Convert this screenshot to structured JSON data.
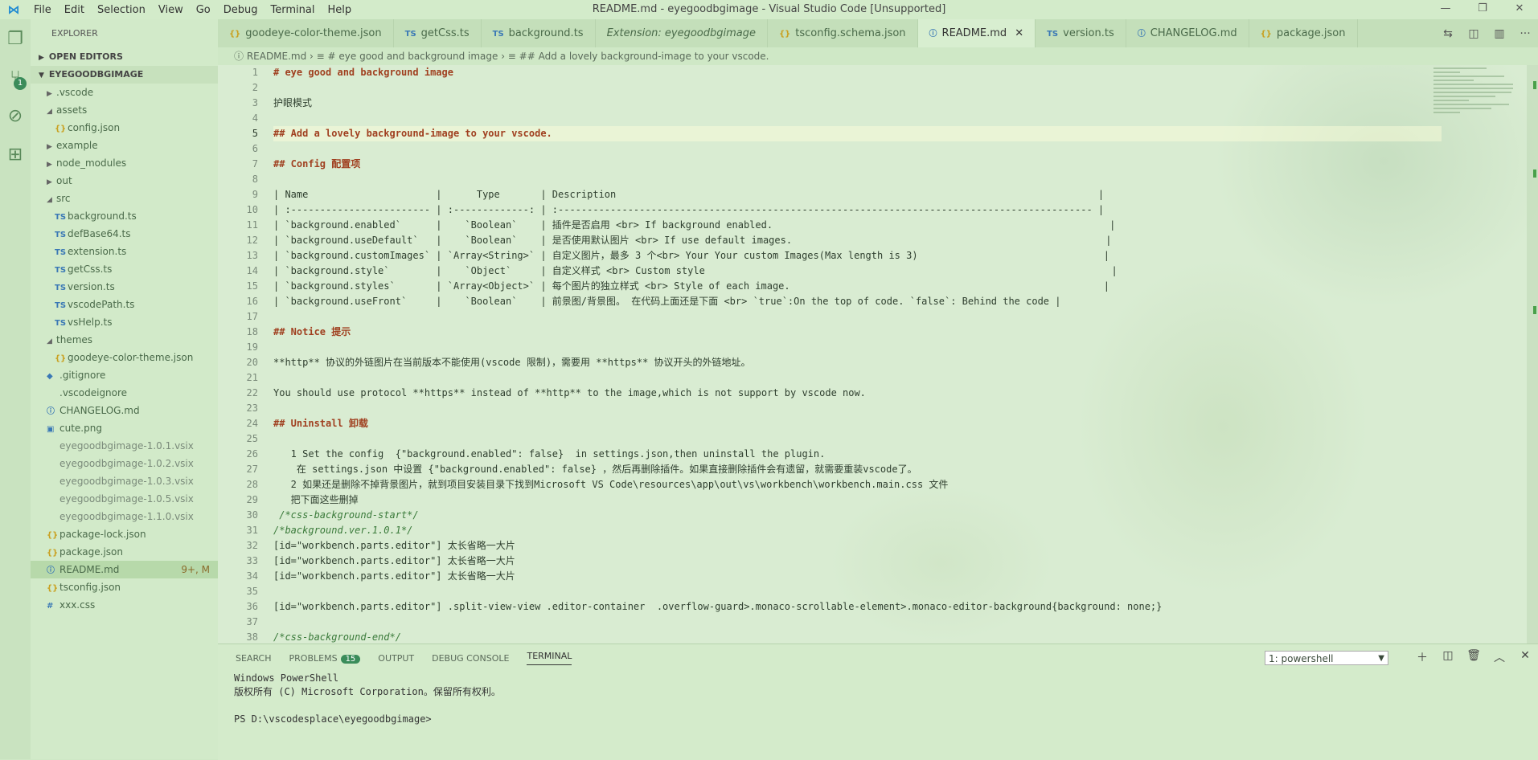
{
  "title": "README.md - eyegoodbgimage - Visual Studio Code [Unsupported]",
  "menu": [
    "File",
    "Edit",
    "Selection",
    "View",
    "Go",
    "Debug",
    "Terminal",
    "Help"
  ],
  "window_controls": [
    "—",
    "❐",
    "✕"
  ],
  "activity": {
    "scm_badge": "1"
  },
  "sidebar": {
    "title": "EXPLORER",
    "open_editors": "OPEN EDITORS",
    "project": "EYEGOODBGIMAGE",
    "items": [
      {
        "label": ".vscode",
        "indent": 1,
        "type": "folder",
        "open": false
      },
      {
        "label": "assets",
        "indent": 1,
        "type": "folder",
        "open": true
      },
      {
        "label": "config.json",
        "indent": 2,
        "type": "json"
      },
      {
        "label": "example",
        "indent": 1,
        "type": "folder",
        "open": false
      },
      {
        "label": "node_modules",
        "indent": 1,
        "type": "folder",
        "open": false
      },
      {
        "label": "out",
        "indent": 1,
        "type": "folder",
        "open": false
      },
      {
        "label": "src",
        "indent": 1,
        "type": "folder",
        "open": true
      },
      {
        "label": "background.ts",
        "indent": 2,
        "type": "ts"
      },
      {
        "label": "defBase64.ts",
        "indent": 2,
        "type": "ts"
      },
      {
        "label": "extension.ts",
        "indent": 2,
        "type": "ts"
      },
      {
        "label": "getCss.ts",
        "indent": 2,
        "type": "ts"
      },
      {
        "label": "version.ts",
        "indent": 2,
        "type": "ts"
      },
      {
        "label": "vscodePath.ts",
        "indent": 2,
        "type": "ts"
      },
      {
        "label": "vsHelp.ts",
        "indent": 2,
        "type": "ts"
      },
      {
        "label": "themes",
        "indent": 1,
        "type": "folder",
        "open": true
      },
      {
        "label": "goodeye-color-theme.json",
        "indent": 2,
        "type": "json"
      },
      {
        "label": ".gitignore",
        "indent": 1,
        "type": "git"
      },
      {
        "label": ".vscodeignore",
        "indent": 1,
        "type": "file"
      },
      {
        "label": "CHANGELOG.md",
        "indent": 1,
        "type": "md"
      },
      {
        "label": "cute.png",
        "indent": 1,
        "type": "img"
      },
      {
        "label": "eyegoodbgimage-1.0.1.vsix",
        "indent": 1,
        "type": "file"
      },
      {
        "label": "eyegoodbgimage-1.0.2.vsix",
        "indent": 1,
        "type": "file"
      },
      {
        "label": "eyegoodbgimage-1.0.3.vsix",
        "indent": 1,
        "type": "file"
      },
      {
        "label": "eyegoodbgimage-1.0.5.vsix",
        "indent": 1,
        "type": "file"
      },
      {
        "label": "eyegoodbgimage-1.1.0.vsix",
        "indent": 1,
        "type": "file"
      },
      {
        "label": "package-lock.json",
        "indent": 1,
        "type": "json"
      },
      {
        "label": "package.json",
        "indent": 1,
        "type": "json"
      },
      {
        "label": "README.md",
        "indent": 1,
        "type": "info",
        "active": true,
        "status": "9+, M"
      },
      {
        "label": "tsconfig.json",
        "indent": 1,
        "type": "json"
      },
      {
        "label": "xxx.css",
        "indent": 1,
        "type": "hash"
      }
    ]
  },
  "tabs": [
    {
      "icon": "{}",
      "label": "goodeye-color-theme.json"
    },
    {
      "icon": "TS",
      "label": "getCss.ts"
    },
    {
      "icon": "TS",
      "label": "background.ts"
    },
    {
      "icon": "",
      "label": "Extension: eyegoodbgimage",
      "italic": true
    },
    {
      "icon": "{}",
      "label": "tsconfig.schema.json"
    },
    {
      "icon": "ⓘ",
      "label": "README.md",
      "active": true,
      "close": "✕"
    },
    {
      "icon": "TS",
      "label": "version.ts"
    },
    {
      "icon": "ⓘ",
      "label": "CHANGELOG.md"
    },
    {
      "icon": "{}",
      "label": "package.json"
    }
  ],
  "breadcrumb": "ⓘ README.md  ›  ≡ # eye good and background image  ›  ≡ ## Add a lovely background-image to your vscode.",
  "editor": {
    "lines": [
      "# eye good and background image",
      "",
      "护眼模式",
      "",
      "## Add a lovely background-image to your vscode.",
      "",
      "## Config 配置项",
      "",
      "| Name                      |      Type       | Description                                                                                   |",
      "| :------------------------ | :-------------: | :-------------------------------------------------------------------------------------------- |",
      "| `background.enabled`      |    `Boolean`    | 插件是否启用 <br> If background enabled.                                                          |",
      "| `background.useDefault`   |    `Boolean`    | 是否使用默认图片 <br> If use default images.                                                      |",
      "| `background.customImages` | `Array<String>` | 自定义图片，最多 3 个<br> Your Your custom Images(Max length is 3)                                |",
      "| `background.style`        |    `Object`     | 自定义样式 <br> Custom style                                                                      |",
      "| `background.styles`       | `Array<Object>` | 每个图片的独立样式 <br> Style of each image.                                                      |",
      "| `background.useFront`     |    `Boolean`    | 前景图/背景图。 在代码上面还是下面 <br> `true`:On the top of code. `false`: Behind the code |",
      "",
      "## Notice 提示",
      "",
      "**http** 协议的外链图片在当前版本不能使用(vscode 限制)，需要用 **https** 协议开头的外链地址。",
      "",
      "You should use protocol **https** instead of **http** to the image,which is not support by vscode now.",
      "",
      "## Uninstall 卸载",
      "",
      "   1 Set the config  {\"background.enabled\": false}  in settings.json,then uninstall the plugin.",
      "    在 settings.json 中设置 {\"background.enabled\": false} ，然后再删除插件。如果直接删除插件会有遗留，就需要重装vscode了。",
      "   2 如果还是删除不掉背景图片，就到项目安装目录下找到Microsoft VS Code\\resources\\app\\out\\vs\\workbench\\workbench.main.css 文件",
      "   把下面这些删掉",
      " /*css-background-start*/",
      "/*background.ver.1.0.1*/",
      "[id=\"workbench.parts.editor\"] 太长省略一大片",
      "[id=\"workbench.parts.editor\"] 太长省略一大片",
      "[id=\"workbench.parts.editor\"] 太长省略一大片",
      "",
      "[id=\"workbench.parts.editor\"] .split-view-view .editor-container  .overflow-guard>.monaco-scrollable-element>.monaco-editor-background{background: none;}",
      "",
      "/*css-background-end*/"
    ],
    "current_line": 5
  },
  "panel": {
    "tabs": [
      "SEARCH",
      "PROBLEMS",
      "OUTPUT",
      "DEBUG CONSOLE",
      "TERMINAL"
    ],
    "problems_count": "15",
    "active_tab": "TERMINAL",
    "terminal_select": "1: powershell",
    "terminal_lines": [
      "Windows PowerShell",
      "版权所有 (C) Microsoft Corporation。保留所有权利。",
      "",
      "PS D:\\vscodesplace\\eyegoodbgimage>"
    ]
  },
  "colors": {
    "accent": "#3a8c5a",
    "background": "#cfe8c6"
  }
}
